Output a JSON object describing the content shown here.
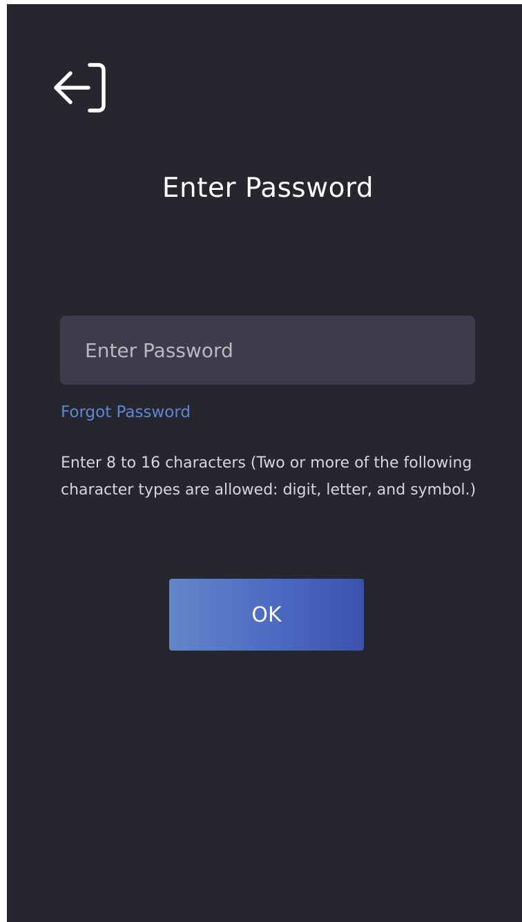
{
  "header": {
    "exit_icon": "exit-icon"
  },
  "title": "Enter Password",
  "password_field": {
    "placeholder": "Enter Password",
    "value": ""
  },
  "forgot_password_label": "Forgot Password",
  "hint": "Enter 8 to 16 characters (Two or more of the following character types are allowed: digit, letter, and symbol.)",
  "ok_label": "OK",
  "colors": {
    "background": "#25262e",
    "input_background": "#3c3c4b",
    "link": "#5e86d6",
    "button_gradient_start": "#6386c9",
    "button_gradient_end": "#3b52ad"
  }
}
